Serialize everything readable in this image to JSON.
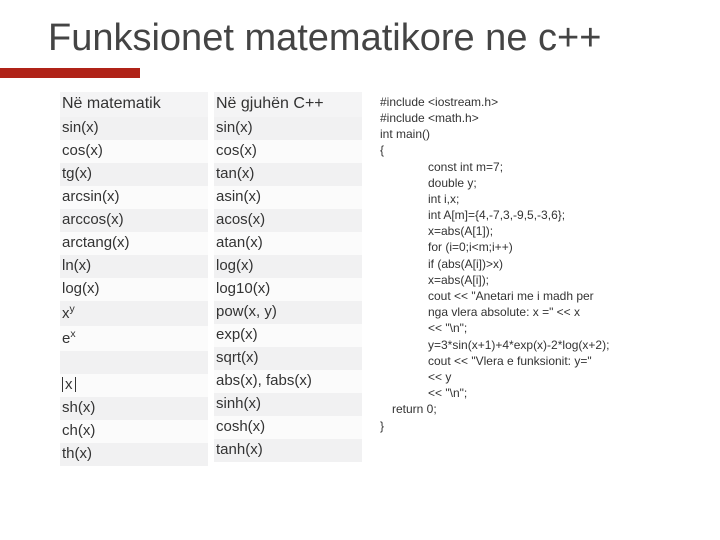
{
  "title": "Funksionet matematikore ne c++",
  "table": {
    "math_header": "Në matematik",
    "cpp_header": "Në gjuhën C++",
    "rows": [
      {
        "math": "sin(x)",
        "cpp": "sin(x)"
      },
      {
        "math": "cos(x)",
        "cpp": "cos(x)"
      },
      {
        "math": "tg(x)",
        "cpp": "tan(x)"
      },
      {
        "math": "arcsin(x)",
        "cpp": "asin(x)"
      },
      {
        "math": "arccos(x)",
        "cpp": "acos(x)"
      },
      {
        "math": "arctang(x)",
        "cpp": "atan(x)"
      },
      {
        "math": "ln(x)",
        "cpp": "log(x)"
      },
      {
        "math": "log(x)",
        "cpp": "log10(x)"
      },
      {
        "math_html": "x<span class='sup'>y</span>",
        "math": "x^y",
        "cpp": "pow(x, y)"
      },
      {
        "math_html": "e<span class='sup'>x</span>",
        "math": "e^x",
        "cpp": "exp(x)"
      },
      {
        "math": "",
        "cpp": "sqrt(x)"
      },
      {
        "math_html": "<span class='abs-bars'>x</span>",
        "math": "|x|",
        "cpp": "abs(x), fabs(x)"
      },
      {
        "math": "sh(x)",
        "cpp": "sinh(x)"
      },
      {
        "math": "ch(x)",
        "cpp": "cosh(x)"
      },
      {
        "math": "th(x)",
        "cpp": "tanh(x)"
      }
    ]
  },
  "code": {
    "lines": [
      {
        "t": "#include <iostream.h>",
        "cls": ""
      },
      {
        "t": "#include <math.h>",
        "cls": ""
      },
      {
        "t": "int main()",
        "cls": ""
      },
      {
        "t": "{",
        "cls": ""
      },
      {
        "t": "const int m=7;",
        "cls": "ind1"
      },
      {
        "t": "double y;",
        "cls": "ind1"
      },
      {
        "t": "int i,x;",
        "cls": "ind1"
      },
      {
        "t": "int A[m]={4,-7,3,-9,5,-3,6};",
        "cls": "ind1"
      },
      {
        "t": "x=abs(A[1]);",
        "cls": "ind1"
      },
      {
        "t": "for (i=0;i<m;i++)",
        "cls": "ind1"
      },
      {
        "t": "if (abs(A[i])>x)",
        "cls": "ind1"
      },
      {
        "t": "x=abs(A[i]);",
        "cls": "ind1"
      },
      {
        "t": "cout << \"Anetari me i madh per",
        "cls": "ind1"
      },
      {
        "t": "nga vlera absolute: x =\"  << x",
        "cls": "ind1"
      },
      {
        "t": "<< \"\\n\";",
        "cls": "ind1"
      },
      {
        "t": "y=3*sin(x+1)+4*exp(x)-2*log(x+2);",
        "cls": "ind1"
      },
      {
        "t": "cout << \"Vlera e funksionit: y=\"",
        "cls": "ind1"
      },
      {
        "t": "      << y",
        "cls": "ind1"
      },
      {
        "t": "      << \"\\n\";",
        "cls": "ind1"
      },
      {
        "t": "return 0;",
        "cls": "ind0b"
      },
      {
        "t": "}",
        "cls": ""
      }
    ]
  }
}
